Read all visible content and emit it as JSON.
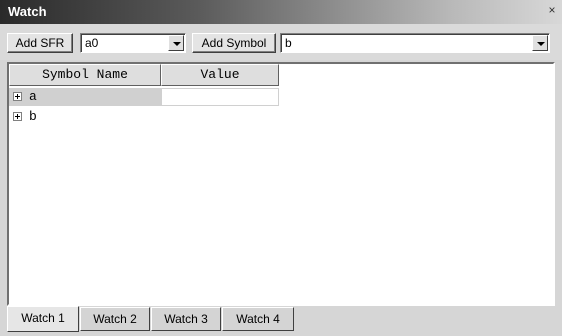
{
  "window": {
    "title": "Watch"
  },
  "toolbar": {
    "add_sfr_label": "Add SFR",
    "sfr_combo_value": "a0",
    "add_symbol_label": "Add Symbol",
    "symbol_combo_value": "b"
  },
  "table": {
    "columns": [
      "Symbol Name",
      "Value"
    ],
    "rows": [
      {
        "symbol": "a",
        "value": ""
      },
      {
        "symbol": "b",
        "value": ""
      }
    ]
  },
  "tabs": [
    {
      "label": "Watch 1",
      "active": true
    },
    {
      "label": "Watch 2",
      "active": false
    },
    {
      "label": "Watch 3",
      "active": false
    },
    {
      "label": "Watch 4",
      "active": false
    }
  ],
  "icons": {
    "close": "close-icon",
    "dropdown": "chevron-down-icon",
    "expand": "plus-box-icon"
  },
  "colors": {
    "selected_row": "#d0d0d0",
    "window_bg": "#d6d6d6"
  }
}
